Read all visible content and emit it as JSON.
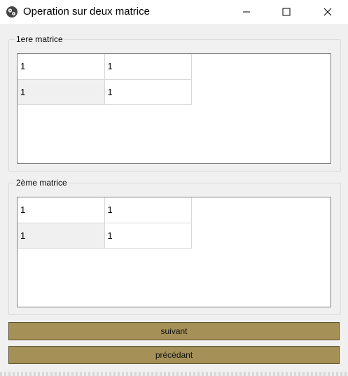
{
  "window": {
    "title": "Operation sur deux matrice",
    "icons": {
      "app": "gears-icon",
      "minimize": "minimize-icon",
      "maximize": "maximize-icon",
      "close": "close-icon"
    }
  },
  "matrix1": {
    "label": "1ere matrice",
    "rows": [
      [
        "1",
        "1"
      ],
      [
        "1",
        "1"
      ]
    ]
  },
  "matrix2": {
    "label": "2ème matrice",
    "rows": [
      [
        "1",
        "1"
      ],
      [
        "1",
        "1"
      ]
    ]
  },
  "buttons": {
    "next_label": "suivant",
    "prev_label": "précédant"
  },
  "colors": {
    "button_bg": "#a59157",
    "window_bg": "#f0f0f0"
  }
}
